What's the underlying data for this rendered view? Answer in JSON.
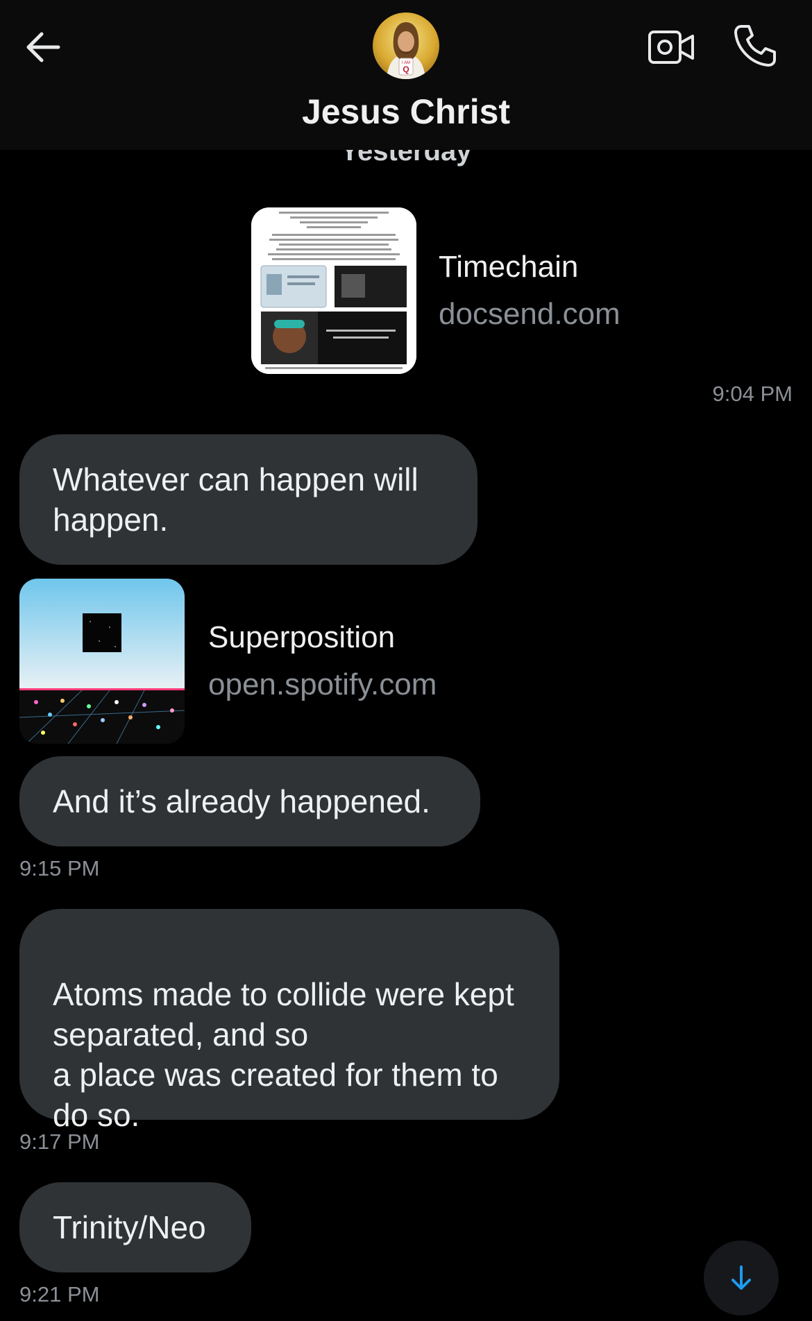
{
  "header": {
    "title": "Jesus Christ",
    "avatar_text_top": "I AM",
    "avatar_text_bottom": "Q"
  },
  "day_peek": "Yesterday",
  "messages": [
    {
      "type": "link",
      "title": "Timechain",
      "domain": "docsend.com",
      "time": "9:04 PM"
    },
    {
      "type": "text",
      "text": "Whatever can happen will happen."
    },
    {
      "type": "link",
      "title": "Superposition",
      "domain": "open.spotify.com"
    },
    {
      "type": "text",
      "text": "And it’s already happened.",
      "time": "9:15 PM"
    },
    {
      "type": "text",
      "text": "Atoms made to collide were kept separated, and so\na place was created for them to do so.",
      "time": "9:17 PM"
    },
    {
      "type": "text",
      "text": "Trinity/Neo",
      "time": "9:21 PM"
    }
  ],
  "icons": {
    "back": "arrow-left-icon",
    "video": "video-camera-icon",
    "call": "phone-icon",
    "scroll": "arrow-down-icon"
  },
  "colors": {
    "background": "#000000",
    "header": "#0b0b0c",
    "bubble": "#2f3336",
    "muted": "#8b9096",
    "accent": "#1d9bf0"
  }
}
